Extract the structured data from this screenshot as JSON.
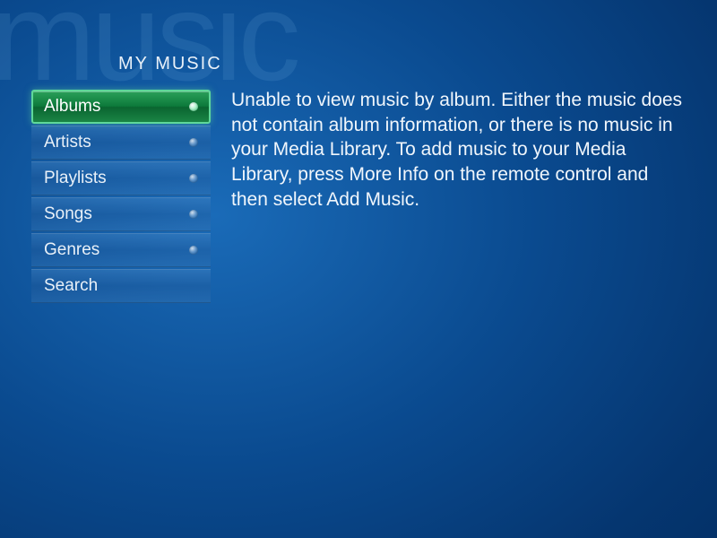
{
  "background": {
    "word": "music"
  },
  "header": {
    "title": "MY MUSIC"
  },
  "sidebar": {
    "items": [
      {
        "label": "Albums",
        "selected": true,
        "has_dot": true
      },
      {
        "label": "Artists",
        "selected": false,
        "has_dot": true
      },
      {
        "label": "Playlists",
        "selected": false,
        "has_dot": true
      },
      {
        "label": "Songs",
        "selected": false,
        "has_dot": true
      },
      {
        "label": "Genres",
        "selected": false,
        "has_dot": true
      },
      {
        "label": "Search",
        "selected": false,
        "has_dot": false
      }
    ]
  },
  "main": {
    "message": "Unable to view music by album. Either the music does not contain album information, or there is no music in your Media Library. To add music to your Media Library, press More Info on the remote control and then select Add Music."
  }
}
